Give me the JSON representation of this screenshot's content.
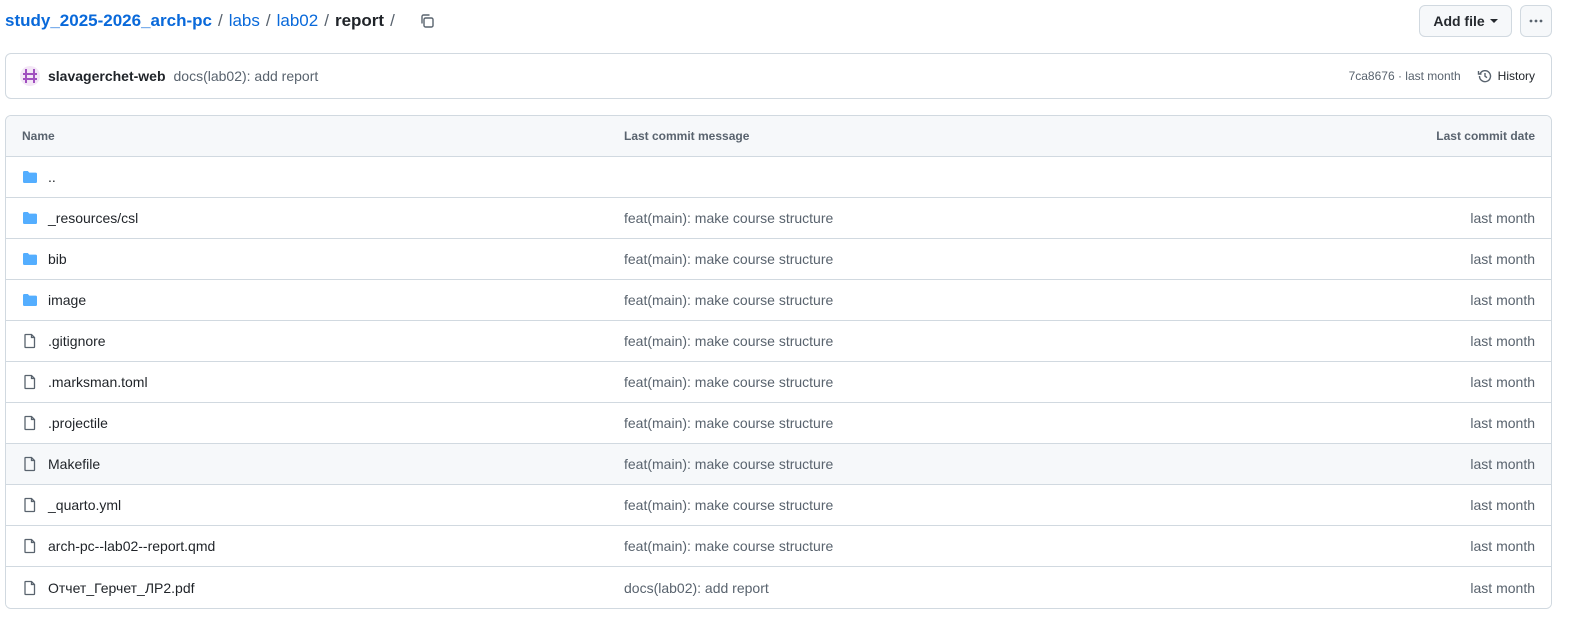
{
  "breadcrumb": {
    "repo": "study_2025-2026_arch-pc",
    "parts": [
      "labs",
      "lab02"
    ],
    "current": "report",
    "separator": "/"
  },
  "toolbar": {
    "add_file_label": "Add file",
    "more_label": "···"
  },
  "commit": {
    "author": "slavagerchet-web",
    "message": "docs(lab02): add report",
    "meta": "7ca8676 · last month",
    "history_label": "History"
  },
  "table": {
    "headers": {
      "name": "Name",
      "message": "Last commit message",
      "date": "Last commit date"
    },
    "rows": [
      {
        "icon": "folder-icon",
        "name": "..",
        "message": "",
        "date": ""
      },
      {
        "icon": "folder-icon",
        "name": "_resources/csl",
        "message": "feat(main): make course structure",
        "date": "last month"
      },
      {
        "icon": "folder-icon",
        "name": "bib",
        "message": "feat(main): make course structure",
        "date": "last month"
      },
      {
        "icon": "folder-icon",
        "name": "image",
        "message": "feat(main): make course structure",
        "date": "last month"
      },
      {
        "icon": "file-icon",
        "name": ".gitignore",
        "message": "feat(main): make course structure",
        "date": "last month"
      },
      {
        "icon": "file-icon",
        "name": ".marksman.toml",
        "message": "feat(main): make course structure",
        "date": "last month"
      },
      {
        "icon": "file-icon",
        "name": ".projectile",
        "message": "feat(main): make course structure",
        "date": "last month"
      },
      {
        "icon": "file-icon",
        "name": "Makefile",
        "message": "feat(main): make course structure",
        "date": "last month"
      },
      {
        "icon": "file-icon",
        "name": "_quarto.yml",
        "message": "feat(main): make course structure",
        "date": "last month"
      },
      {
        "icon": "file-icon",
        "name": "arch-pc--lab02--report.qmd",
        "message": "feat(main): make course structure",
        "date": "last month"
      },
      {
        "icon": "file-icon",
        "name": "Отчет_Герчет_ЛР2.pdf",
        "message": "docs(lab02): add report",
        "date": "last month"
      }
    ]
  },
  "colors": {
    "link": "#0969da",
    "folder": "#54aeff",
    "muted": "#59636e",
    "border": "#d1d9e0"
  }
}
